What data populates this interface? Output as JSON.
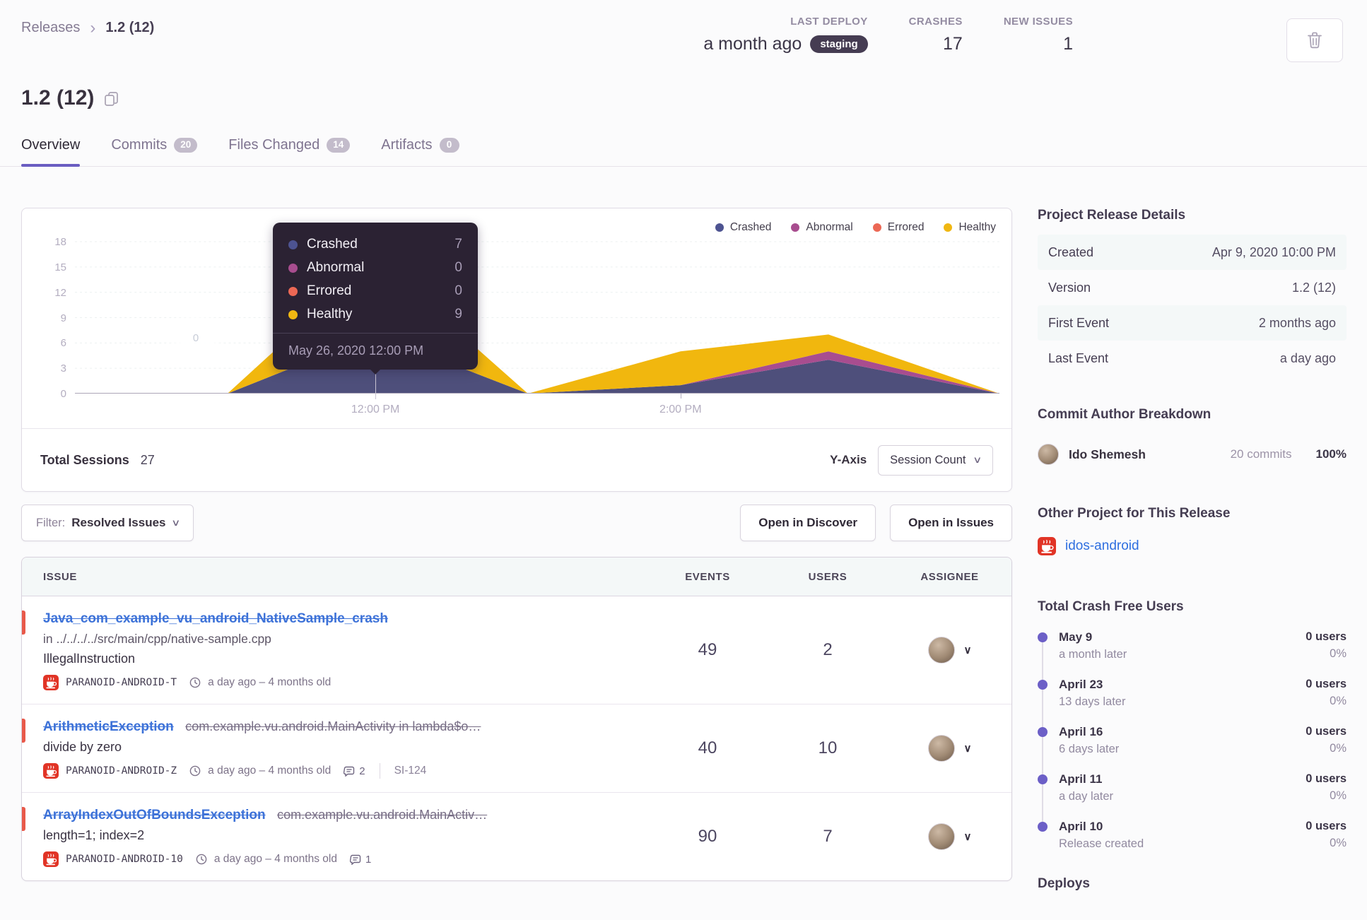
{
  "colors": {
    "accent_purple": "#6a5dc1",
    "link_blue": "#3d72d8",
    "error_red": "#e8594a",
    "tooltip_bg": "#2b2233"
  },
  "breadcrumb": {
    "root": "Releases",
    "current": "1.2 (12)"
  },
  "header": {
    "title": "1.2 (12)",
    "stats": [
      {
        "label": "LAST DEPLOY",
        "value": "a month ago",
        "badge": "staging"
      },
      {
        "label": "CRASHES",
        "value": "17"
      },
      {
        "label": "NEW ISSUES",
        "value": "1"
      }
    ]
  },
  "tabs": [
    {
      "label": "Overview"
    },
    {
      "label": "Commits",
      "badge": "20"
    },
    {
      "label": "Files Changed",
      "badge": "14"
    },
    {
      "label": "Artifacts",
      "badge": "0"
    }
  ],
  "chart_data": {
    "type": "area",
    "stacked": true,
    "grid": "horizontal-dashed",
    "legend_position": "top-right",
    "ylim": [
      0,
      18
    ],
    "yticks": [
      0,
      3,
      6,
      9,
      12,
      15,
      18
    ],
    "xticks": [
      {
        "label": "12:00 PM",
        "pos": 0.325
      },
      {
        "label": "2:00 PM",
        "pos": 0.655
      }
    ],
    "series": [
      {
        "name": "Crashed",
        "area_color": "#4e4f7b",
        "dot_color": "#4d5391"
      },
      {
        "name": "Abnormal",
        "area_color": "#a84d8f",
        "dot_color": "#a84d8f"
      },
      {
        "name": "Errored",
        "area_color": "#ec6855",
        "dot_color": "#ec6855"
      },
      {
        "name": "Healthy",
        "area_color": "#f1b70e",
        "dot_color": "#f0b712"
      }
    ],
    "points": [
      {
        "x": 0.0,
        "Crashed": 0,
        "Abnormal": 0,
        "Errored": 0,
        "Healthy": 0
      },
      {
        "x": 0.165,
        "Crashed": 0,
        "Abnormal": 0,
        "Errored": 0,
        "Healthy": 0
      },
      {
        "x": 0.325,
        "Crashed": 7,
        "Abnormal": 0,
        "Errored": 0,
        "Healthy": 9
      },
      {
        "x": 0.49,
        "Crashed": 0,
        "Abnormal": 0,
        "Errored": 0,
        "Healthy": 0
      },
      {
        "x": 0.655,
        "Crashed": 1,
        "Abnormal": 0,
        "Errored": 0,
        "Healthy": 4
      },
      {
        "x": 0.815,
        "Crashed": 4,
        "Abnormal": 1,
        "Errored": 0,
        "Healthy": 2
      },
      {
        "x": 1.0,
        "Crashed": 0,
        "Abnormal": 0,
        "Errored": 0,
        "Healthy": 0
      }
    ],
    "hover_marker_label": "0",
    "tooltip": {
      "anchor_pos": 0.325,
      "rows": [
        {
          "name": "Crashed",
          "value": "7",
          "color": "#4d5391"
        },
        {
          "name": "Abnormal",
          "value": "0",
          "color": "#a84d8f"
        },
        {
          "name": "Errored",
          "value": "0",
          "color": "#ec6855"
        },
        {
          "name": "Healthy",
          "value": "9",
          "color": "#f0b712"
        }
      ],
      "date": "May 26, 2020 12:00 PM"
    }
  },
  "chart_footer": {
    "total_label": "Total Sessions",
    "total_value": "27",
    "yaxis_label": "Y-Axis",
    "yaxis_value": "Session Count"
  },
  "filter": {
    "label": "Filter:",
    "value": "Resolved Issues"
  },
  "actions": {
    "discover": "Open in Discover",
    "issues": "Open in Issues"
  },
  "issues_table": {
    "columns": [
      "ISSUE",
      "EVENTS",
      "USERS",
      "ASSIGNEE"
    ],
    "rows": [
      {
        "title": "Java_com_example_vu_android_NativeSample_crash",
        "location": "in ../../../../src/main/cpp/native-sample.cpp",
        "subtitle": "IllegalInstruction",
        "project": "PARANOID-ANDROID-T",
        "age": "a day ago – 4 months old",
        "events": "49",
        "users": "2"
      },
      {
        "title": "ArithmeticException",
        "culprit": "com.example.vu.android.MainActivity in lambda$o…",
        "subtitle": "divide by zero",
        "project": "PARANOID-ANDROID-Z",
        "age": "a day ago – 4 months old",
        "comments": "2",
        "short_id": "SI-124",
        "events": "40",
        "users": "10"
      },
      {
        "title": "ArrayIndexOutOfBoundsException",
        "culprit": "com.example.vu.android.MainActiv…",
        "subtitle": "length=1; index=2",
        "project": "PARANOID-ANDROID-10",
        "age": "a day ago – 4 months old",
        "comments": "1",
        "events": "90",
        "users": "7"
      }
    ]
  },
  "sidebar": {
    "release_details": {
      "heading": "Project Release Details",
      "rows": [
        {
          "key": "Created",
          "value": "Apr 9, 2020 10:00 PM"
        },
        {
          "key": "Version",
          "value": "1.2 (12)"
        },
        {
          "key": "First Event",
          "value": "2 months ago"
        },
        {
          "key": "Last Event",
          "value": "a day ago"
        }
      ]
    },
    "commit_authors": {
      "heading": "Commit Author Breakdown",
      "rows": [
        {
          "name": "Ido Shemesh",
          "commits": "20 commits",
          "percent": "100%"
        }
      ]
    },
    "other_project": {
      "heading": "Other Project for This Release",
      "project": "idos-android"
    },
    "crash_free": {
      "heading": "Total Crash Free Users",
      "entries": [
        {
          "date": "May 9",
          "sub": "a month later",
          "users": "0 users",
          "percent": "0%"
        },
        {
          "date": "April 23",
          "sub": "13 days later",
          "users": "0 users",
          "percent": "0%"
        },
        {
          "date": "April 16",
          "sub": "6 days later",
          "users": "0 users",
          "percent": "0%"
        },
        {
          "date": "April 11",
          "sub": "a day later",
          "users": "0 users",
          "percent": "0%"
        },
        {
          "date": "April 10",
          "sub": "Release created",
          "users": "0 users",
          "percent": "0%"
        }
      ]
    },
    "deploys": {
      "heading": "Deploys"
    }
  }
}
